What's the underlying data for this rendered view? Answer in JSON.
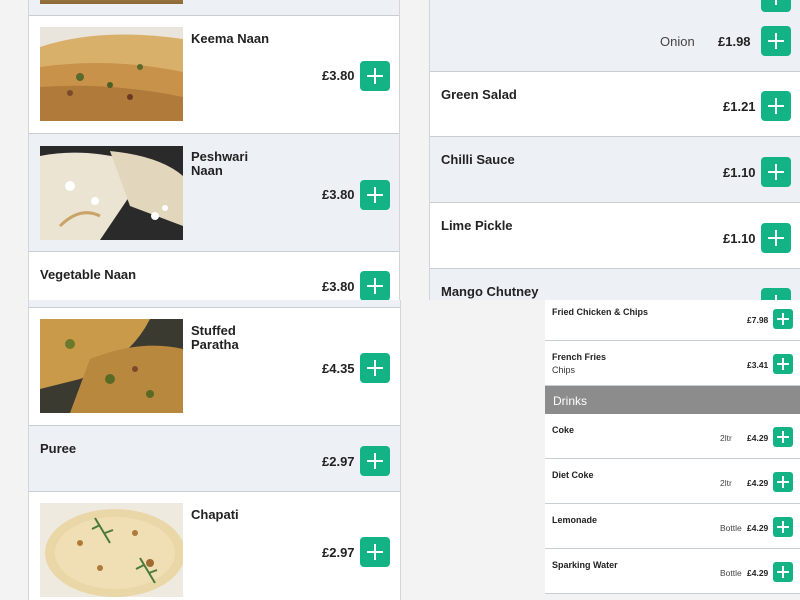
{
  "top_left": {
    "items": [
      {
        "name": "Keema Naan",
        "price": "£3.80"
      },
      {
        "name": "Peshwari Naan",
        "price": "£3.80"
      },
      {
        "name": "Vegetable Naan",
        "price": "£3.80"
      }
    ]
  },
  "top_right": {
    "partial_top": {
      "variant": "Onion",
      "price": "£1.98"
    },
    "items": [
      {
        "name": "Green Salad",
        "price": "£1.21"
      },
      {
        "name": "Chilli Sauce",
        "price": "£1.10"
      },
      {
        "name": "Lime Pickle",
        "price": "£1.10"
      },
      {
        "name": "Mango Chutney",
        "price": ""
      }
    ]
  },
  "bottom_left": {
    "items": [
      {
        "name": "Stuffed Paratha",
        "price": "£4.35"
      },
      {
        "name": "Puree",
        "price": "£2.97"
      },
      {
        "name": "Chapati",
        "price": "£2.97"
      }
    ]
  },
  "bottom_right": {
    "items_before": [
      {
        "name": "Fried Chicken & Chips",
        "sub": "",
        "variant": "",
        "price": "£7.98"
      },
      {
        "name": "French Fries",
        "sub": "Chips",
        "variant": "",
        "price": "£3.41"
      }
    ],
    "section_title": "Drinks",
    "drinks": [
      {
        "name": "Coke",
        "variant": "2ltr",
        "price": "£4.29"
      },
      {
        "name": "Diet Coke",
        "variant": "2ltr",
        "price": "£4.29"
      },
      {
        "name": "Lemonade",
        "variant": "Bottle",
        "price": "£4.29"
      },
      {
        "name": "Sparking Water",
        "variant": "Bottle",
        "price": "£4.29"
      }
    ]
  },
  "colors": {
    "accent": "#14b386",
    "row_alt": "#edf1f5",
    "section_header": "#8c8c8c"
  }
}
